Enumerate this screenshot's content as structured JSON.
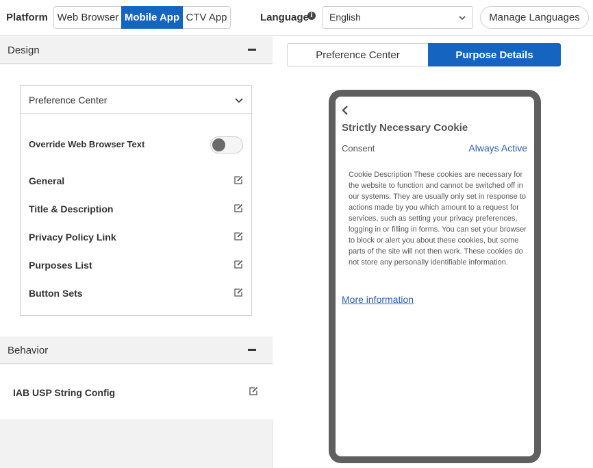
{
  "topbar": {
    "platform_label": "Platform",
    "platforms": [
      "Web Browser",
      "Mobile App",
      "CTV App"
    ],
    "selected_platform": "Mobile App",
    "language_label": "Language",
    "language_value": "English",
    "manage_languages": "Manage Languages"
  },
  "design": {
    "title": "Design",
    "card_title": "Preference Center",
    "override_label": "Override Web Browser Text",
    "override_on": false,
    "items": [
      "General",
      "Title & Description",
      "Privacy Policy Link",
      "Purposes List",
      "Button Sets"
    ]
  },
  "behavior": {
    "title": "Behavior",
    "items": [
      "IAB USP String Config"
    ]
  },
  "preview": {
    "tabs": [
      "Preference Center",
      "Purpose Details"
    ],
    "active_tab": "Purpose Details",
    "title": "Strictly Necessary Cookie",
    "consent_label": "Consent",
    "status": "Always Active",
    "description": "Cookie Description These cookies are necessary for the website to function and cannot be switched off in our systems. They are usually only set in response to actions made by you which amount to a request for services, such as setting your privacy preferences, logging in or filling in forms. You can set your browser to block or alert you about these cookies, but some parts of the site will not then work. These cookies do not store any personally identifiable information.",
    "more_link": "More information"
  },
  "colors": {
    "accent": "#1565c0",
    "link": "#2a5db8",
    "phone_frame": "#5f5f5f",
    "panel_bg": "#f2f2f2"
  }
}
